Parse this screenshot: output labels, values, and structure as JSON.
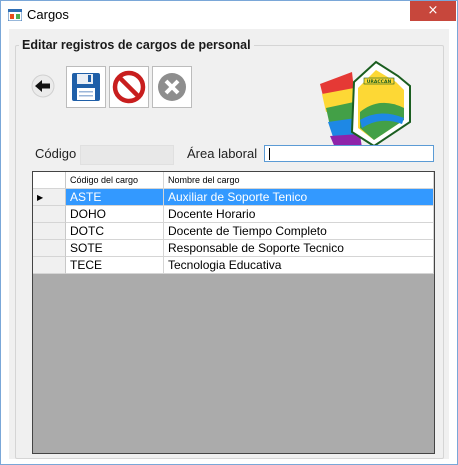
{
  "window": {
    "title": "Cargos",
    "close_symbol": "×"
  },
  "group": {
    "title": "Editar registros de cargos de personal"
  },
  "toolbar": {
    "back_icon": "arrow-left-icon",
    "save_icon": "floppy-disk-icon",
    "cancel_icon": "prohibited-icon",
    "delete_icon": "x-circle-icon"
  },
  "logo": {
    "text": "URACCAN"
  },
  "form": {
    "codigo_label": "Código",
    "codigo_value": "",
    "area_label": "Área laboral",
    "area_value": ""
  },
  "grid": {
    "columns": [
      "Código del cargo",
      "Nombre del cargo"
    ],
    "current_row_marker": "▶",
    "rows": [
      {
        "codigo": "ASTE",
        "nombre": "Auxiliar de Soporte Tenico"
      },
      {
        "codigo": "DOHO",
        "nombre": "Docente Horario"
      },
      {
        "codigo": "DOTC",
        "nombre": "Docente de Tiempo Completo"
      },
      {
        "codigo": "SOTE",
        "nombre": "Responsable de Soporte Tecnico"
      },
      {
        "codigo": "TECE",
        "nombre": "Tecnologia Educativa"
      }
    ]
  },
  "colors": {
    "selection": "#3399ff",
    "close_button": "#c7473c",
    "input_border": "#5b9bd5"
  }
}
